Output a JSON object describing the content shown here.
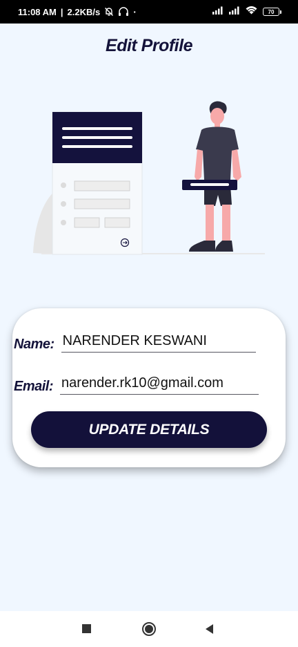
{
  "status_bar": {
    "time": "11:08 AM",
    "separator": "|",
    "network_speed": "2.2KB/s",
    "battery_level": "70",
    "icons": [
      "notifications-off-icon",
      "headphones-icon",
      "signal-icon",
      "signal-icon",
      "wifi-icon",
      "battery-icon"
    ]
  },
  "header": {
    "title": "Edit Profile"
  },
  "illustration": {
    "name": "profile-form-illustration",
    "colors": {
      "dark": "#14123d",
      "line": "#dcdcdc",
      "skin": "#f7a9a9",
      "shirt": "#3a3a4d",
      "plant": "#e6e6e6"
    }
  },
  "form": {
    "name_label": "Name:",
    "name_value": "NARENDER KESWANI",
    "email_label": "Email:",
    "email_value": "narender.rk10@gmail.com",
    "submit_label": "UPDATE DETAILS"
  },
  "nav_bar": {
    "icons": [
      "recents-square-icon",
      "home-circle-icon",
      "back-triangle-icon"
    ]
  },
  "colors": {
    "background": "#f0f7ff",
    "primary": "#13113a",
    "card": "#ffffff"
  }
}
